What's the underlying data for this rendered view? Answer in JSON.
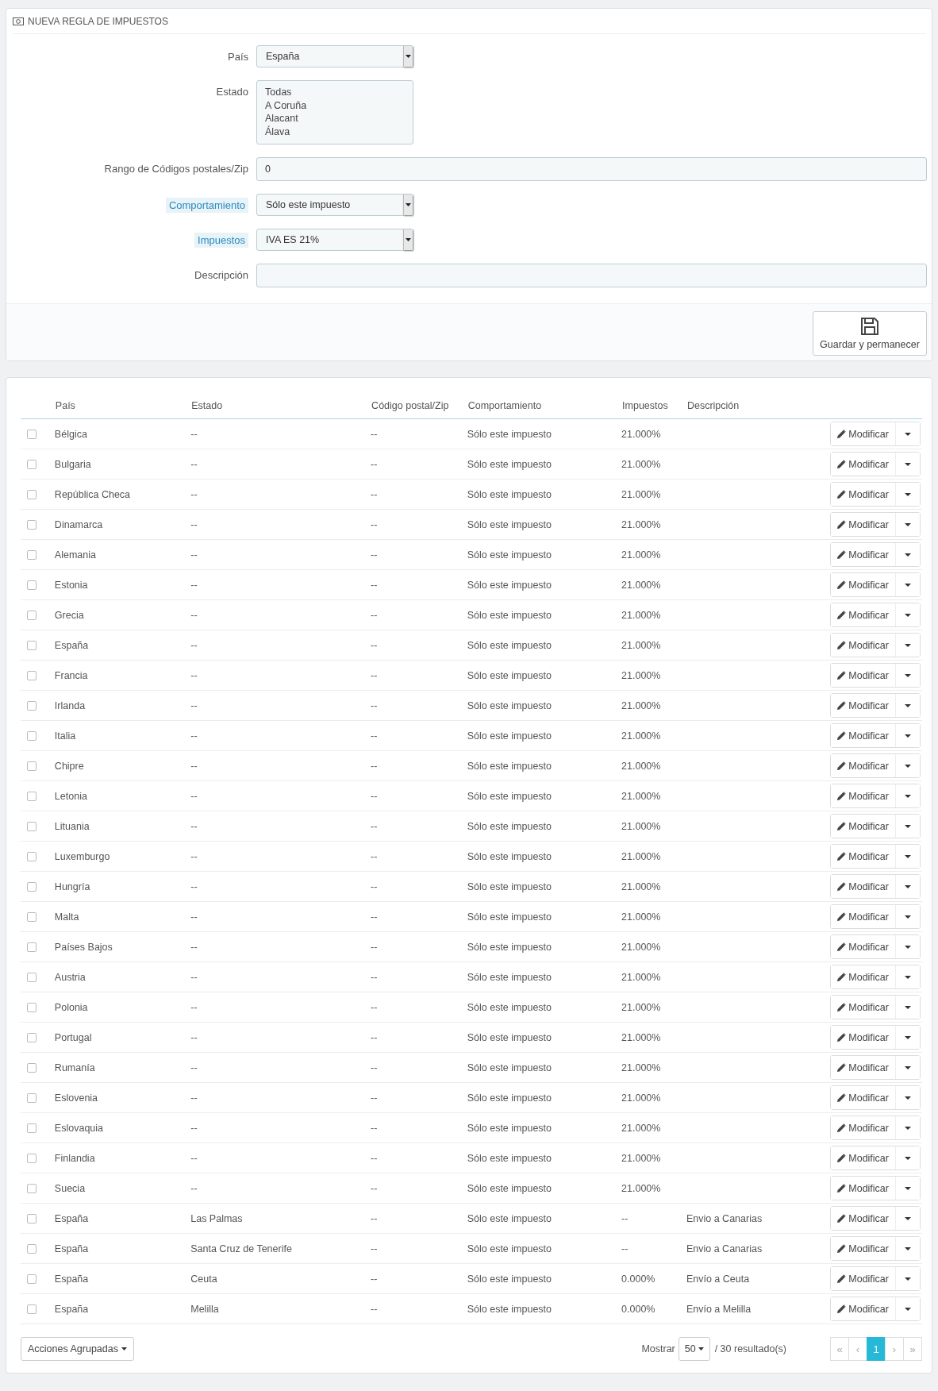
{
  "form": {
    "title": "NUEVA REGLA DE IMPUESTOS",
    "fields": [
      {
        "kind": "select",
        "label": "País",
        "help": false,
        "value": "España"
      },
      {
        "kind": "listbox",
        "label": "Estado",
        "help": false,
        "options": [
          "Todas",
          "A Coruña",
          "Alacant",
          "Álava"
        ]
      },
      {
        "kind": "text",
        "label": "Rango de Códigos postales/Zip",
        "help": false,
        "value": "0"
      },
      {
        "kind": "select",
        "label": "Comportamiento",
        "help": true,
        "value": "Sólo este impuesto"
      },
      {
        "kind": "select",
        "label": "Impuestos",
        "help": true,
        "value": "IVA ES 21%"
      },
      {
        "kind": "text",
        "label": "Descripción",
        "help": false
      }
    ],
    "save_button": "Guardar y permanecer"
  },
  "table": {
    "columns": [
      "País",
      "Estado",
      "Código postal/Zip",
      "Comportamiento",
      "Impuestos",
      "Descripción"
    ],
    "rows": [
      {
        "checked": false,
        "cells": [
          "Bélgica",
          "--",
          "--",
          "Sólo este impuesto",
          "21.000%",
          null
        ],
        "action": "Modificar"
      },
      {
        "checked": false,
        "cells": [
          "Bulgaria",
          "--",
          "--",
          "Sólo este impuesto",
          "21.000%",
          null
        ],
        "action": "Modificar"
      },
      {
        "checked": false,
        "cells": [
          "República Checa",
          "--",
          "--",
          "Sólo este impuesto",
          "21.000%",
          null
        ],
        "action": "Modificar"
      },
      {
        "checked": false,
        "cells": [
          "Dinamarca",
          "--",
          "--",
          "Sólo este impuesto",
          "21.000%",
          null
        ],
        "action": "Modificar"
      },
      {
        "checked": false,
        "cells": [
          "Alemania",
          "--",
          "--",
          "Sólo este impuesto",
          "21.000%",
          null
        ],
        "action": "Modificar"
      },
      {
        "checked": false,
        "cells": [
          "Estonia",
          "--",
          "--",
          "Sólo este impuesto",
          "21.000%",
          null
        ],
        "action": "Modificar"
      },
      {
        "checked": false,
        "cells": [
          "Grecia",
          "--",
          "--",
          "Sólo este impuesto",
          "21.000%",
          null
        ],
        "action": "Modificar"
      },
      {
        "checked": false,
        "cells": [
          "España",
          "--",
          "--",
          "Sólo este impuesto",
          "21.000%",
          null
        ],
        "action": "Modificar"
      },
      {
        "checked": false,
        "cells": [
          "Francia",
          "--",
          "--",
          "Sólo este impuesto",
          "21.000%",
          null
        ],
        "action": "Modificar"
      },
      {
        "checked": false,
        "cells": [
          "Irlanda",
          "--",
          "--",
          "Sólo este impuesto",
          "21.000%",
          null
        ],
        "action": "Modificar"
      },
      {
        "checked": false,
        "cells": [
          "Italia",
          "--",
          "--",
          "Sólo este impuesto",
          "21.000%",
          null
        ],
        "action": "Modificar"
      },
      {
        "checked": false,
        "cells": [
          "Chipre",
          "--",
          "--",
          "Sólo este impuesto",
          "21.000%",
          null
        ],
        "action": "Modificar"
      },
      {
        "checked": false,
        "cells": [
          "Letonia",
          "--",
          "--",
          "Sólo este impuesto",
          "21.000%",
          null
        ],
        "action": "Modificar"
      },
      {
        "checked": false,
        "cells": [
          "Lituania",
          "--",
          "--",
          "Sólo este impuesto",
          "21.000%",
          null
        ],
        "action": "Modificar"
      },
      {
        "checked": false,
        "cells": [
          "Luxemburgo",
          "--",
          "--",
          "Sólo este impuesto",
          "21.000%",
          null
        ],
        "action": "Modificar"
      },
      {
        "checked": false,
        "cells": [
          "Hungría",
          "--",
          "--",
          "Sólo este impuesto",
          "21.000%",
          null
        ],
        "action": "Modificar"
      },
      {
        "checked": false,
        "cells": [
          "Malta",
          "--",
          "--",
          "Sólo este impuesto",
          "21.000%",
          null
        ],
        "action": "Modificar"
      },
      {
        "checked": false,
        "cells": [
          "Países Bajos",
          "--",
          "--",
          "Sólo este impuesto",
          "21.000%",
          null
        ],
        "action": "Modificar"
      },
      {
        "checked": false,
        "cells": [
          "Austria",
          "--",
          "--",
          "Sólo este impuesto",
          "21.000%",
          null
        ],
        "action": "Modificar"
      },
      {
        "checked": false,
        "cells": [
          "Polonia",
          "--",
          "--",
          "Sólo este impuesto",
          "21.000%",
          null
        ],
        "action": "Modificar"
      },
      {
        "checked": false,
        "cells": [
          "Portugal",
          "--",
          "--",
          "Sólo este impuesto",
          "21.000%",
          null
        ],
        "action": "Modificar"
      },
      {
        "checked": false,
        "cells": [
          "Rumanía",
          "--",
          "--",
          "Sólo este impuesto",
          "21.000%",
          null
        ],
        "action": "Modificar"
      },
      {
        "checked": false,
        "cells": [
          "Eslovenia",
          "--",
          "--",
          "Sólo este impuesto",
          "21.000%",
          null
        ],
        "action": "Modificar"
      },
      {
        "checked": false,
        "cells": [
          "Eslovaquia",
          "--",
          "--",
          "Sólo este impuesto",
          "21.000%",
          null
        ],
        "action": "Modificar"
      },
      {
        "checked": false,
        "cells": [
          "Finlandia",
          "--",
          "--",
          "Sólo este impuesto",
          "21.000%",
          null
        ],
        "action": "Modificar"
      },
      {
        "checked": false,
        "cells": [
          "Suecia",
          "--",
          "--",
          "Sólo este impuesto",
          "21.000%",
          null
        ],
        "action": "Modificar"
      },
      {
        "checked": false,
        "cells": [
          "España",
          "Las Palmas",
          "--",
          "Sólo este impuesto",
          "--",
          "Envio a Canarias"
        ],
        "action": "Modificar"
      },
      {
        "checked": false,
        "cells": [
          "España",
          "Santa Cruz de Tenerife",
          "--",
          "Sólo este impuesto",
          "--",
          "Envio a Canarias"
        ],
        "action": "Modificar"
      },
      {
        "checked": false,
        "cells": [
          "España",
          "Ceuta",
          "--",
          "Sólo este impuesto",
          "0.000%",
          "Envío a Ceuta"
        ],
        "action": "Modificar"
      },
      {
        "checked": false,
        "cells": [
          "España",
          "Melilla",
          "--",
          "Sólo este impuesto",
          "0.000%",
          "Envío a Melilla"
        ],
        "action": "Modificar"
      }
    ],
    "bulk_button": "Acciones Agrupadas",
    "show_label": "Mostrar",
    "page_size": "50",
    "result_count": "/ 30 resultado(s)",
    "pagination": [
      {
        "label": "«",
        "selected": false
      },
      {
        "label": "‹",
        "selected": false
      },
      {
        "label": "1",
        "selected": true
      },
      {
        "label": "›",
        "selected": false
      },
      {
        "label": "»",
        "selected": false
      }
    ]
  }
}
